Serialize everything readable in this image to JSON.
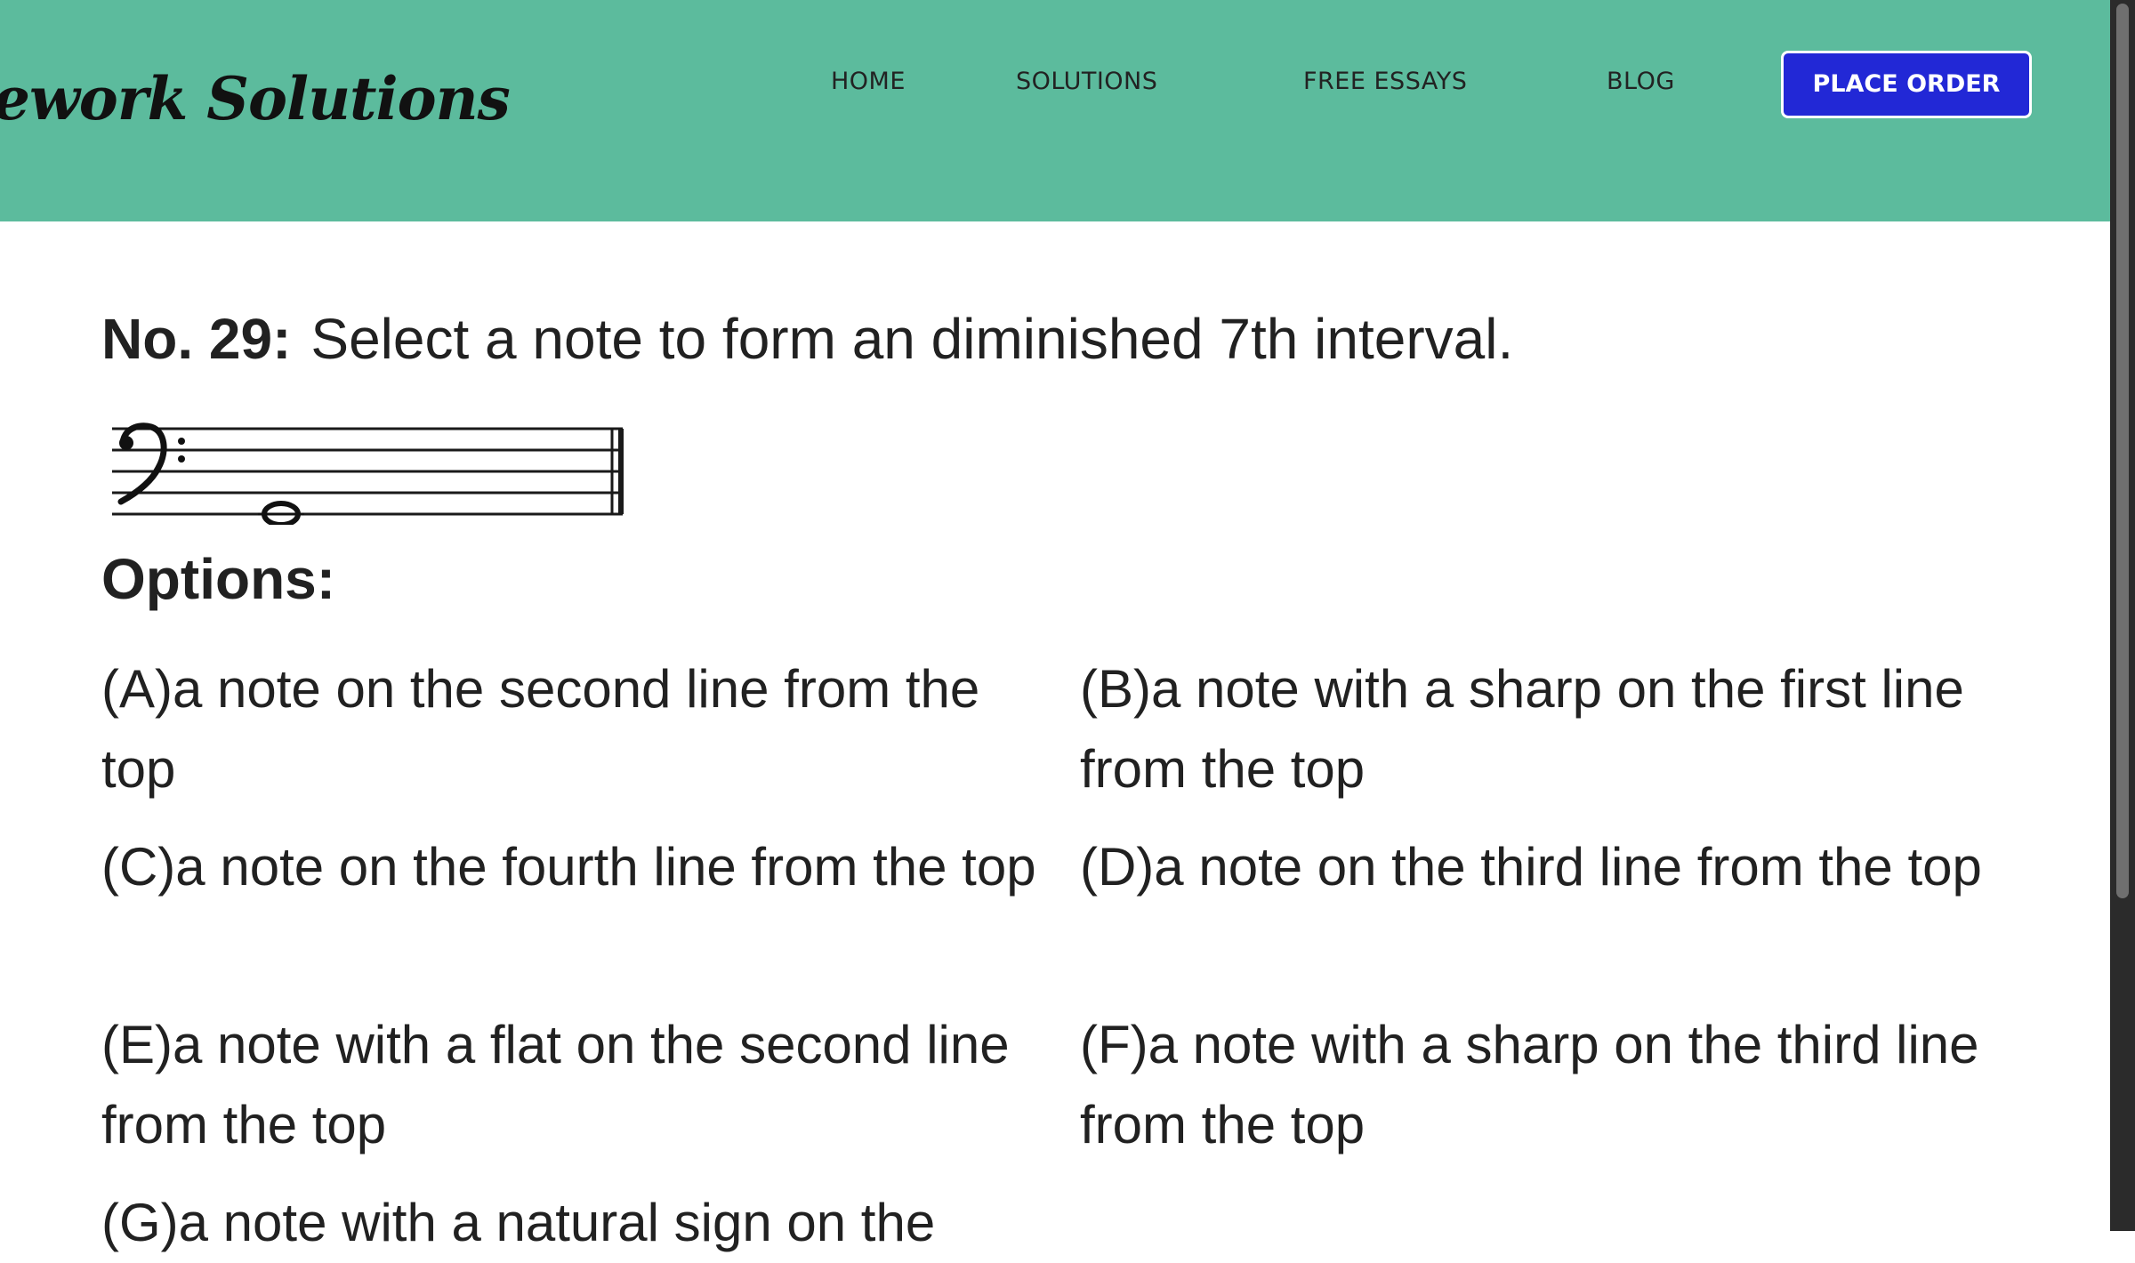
{
  "header": {
    "logo_text": "ework Solutions",
    "nav": [
      "HOME",
      "SOLUTIONS",
      "FREE ESSAYS",
      "BLOG"
    ],
    "cta_label": "PLACE ORDER"
  },
  "question": {
    "number": "No. 29:",
    "text": "Select a note to form an diminished 7th interval."
  },
  "options_title": "Options:",
  "options": [
    "(A)a note on the second line from the top",
    "(B)a note with a sharp on the first line from the top",
    "(C)a note on the fourth line from the top",
    "(D)a note on the third line from the top",
    "(E)a note with a flat on the second line from the top",
    "(F)a note with a sharp on the third line from the top",
    "(G)a note with a natural sign on the"
  ],
  "colors": {
    "header_bg": "#5cbb9d",
    "cta_bg": "#2228d6",
    "text": "#212121"
  },
  "icons": [
    "bass-clef-icon",
    "whole-note-icon"
  ]
}
